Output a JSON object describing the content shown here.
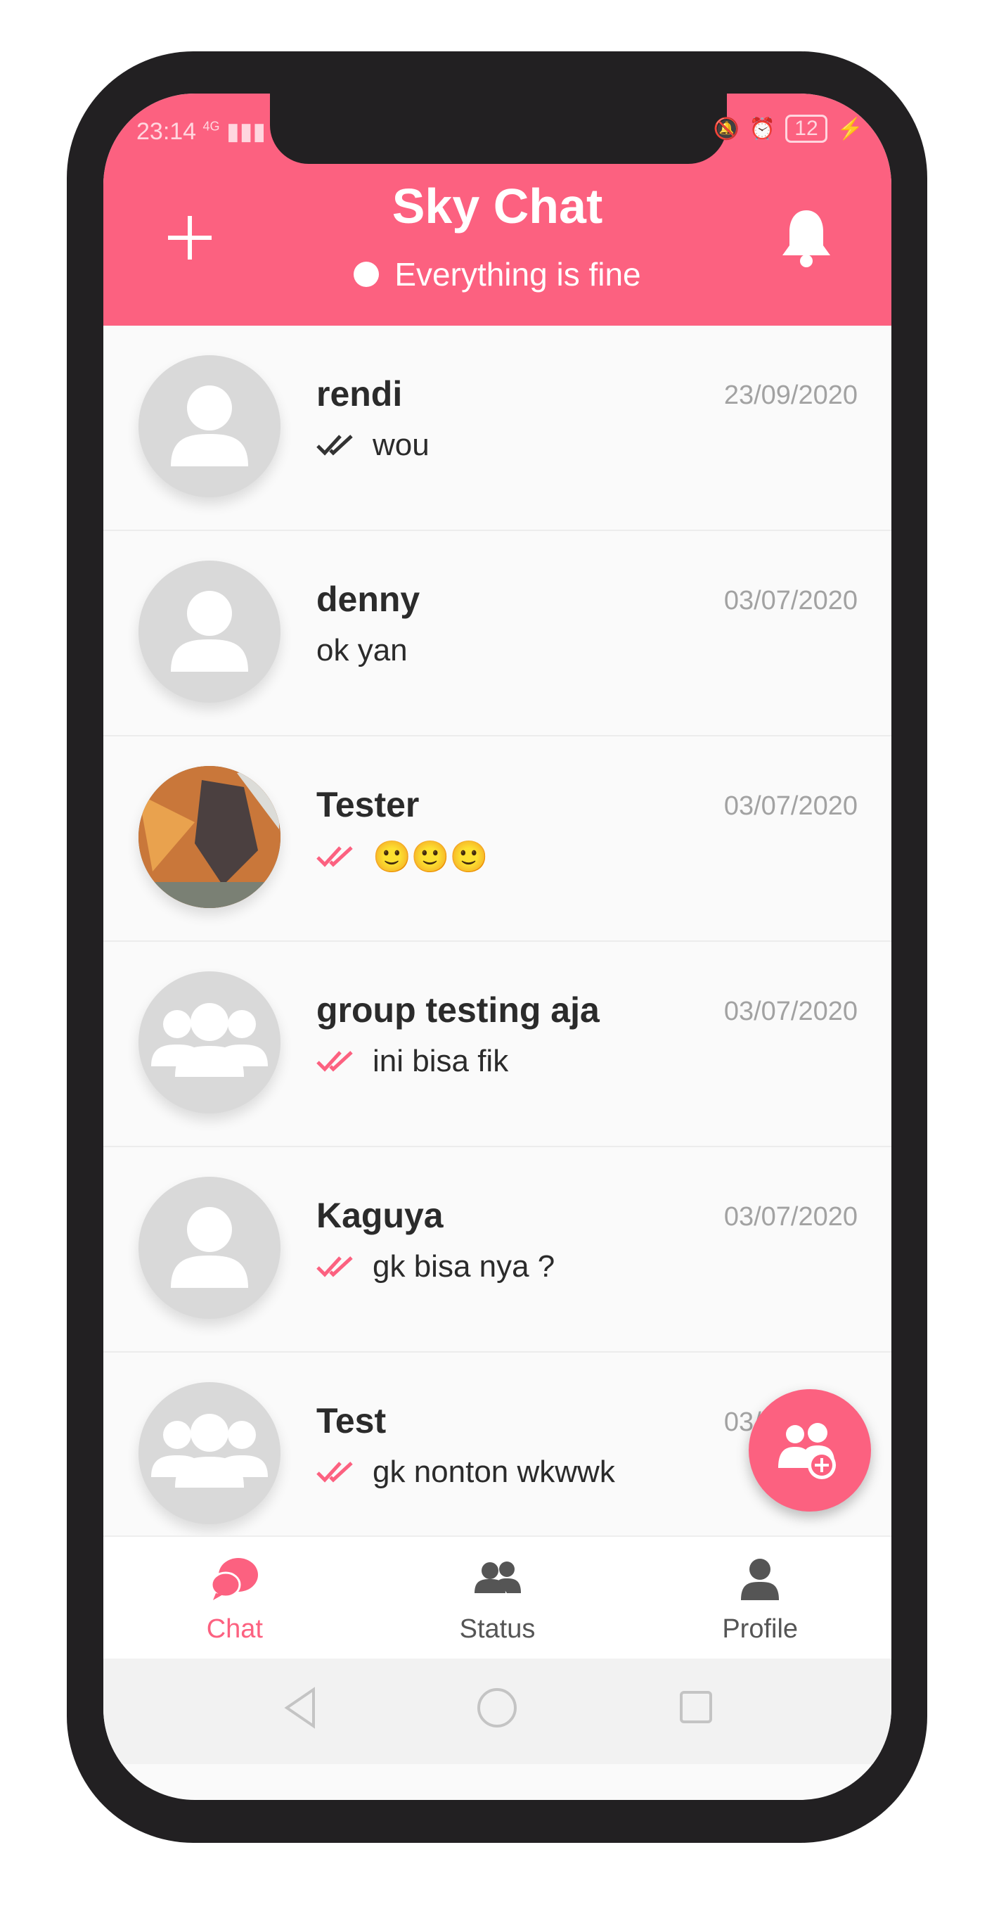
{
  "status_bar": {
    "time": "23:14",
    "signal": "4G",
    "battery": "12"
  },
  "header": {
    "title": "Sky Chat",
    "subtitle": "Everything is fine"
  },
  "chats": [
    {
      "name": "rendi",
      "date": "23/09/2020",
      "message": "wou",
      "tick": "read-dark",
      "avatar": "person-icon"
    },
    {
      "name": "denny",
      "date": "03/07/2020",
      "message": "ok yan",
      "tick": "none",
      "avatar": "person-icon"
    },
    {
      "name": "Tester",
      "date": "03/07/2020",
      "message": "🙂🙂🙂",
      "tick": "read-pink",
      "avatar": "photo"
    },
    {
      "name": "group testing aja",
      "date": "03/07/2020",
      "message": "ini bisa fik",
      "tick": "read-pink",
      "avatar": "group-icon"
    },
    {
      "name": "Kaguya",
      "date": "03/07/2020",
      "message": "gk bisa nya ?",
      "tick": "read-pink",
      "avatar": "person-icon"
    },
    {
      "name": "Test",
      "date": "03/07/2020",
      "message": "gk nonton wkwwk",
      "tick": "read-pink",
      "avatar": "group-icon"
    }
  ],
  "bottom_nav": [
    {
      "label": "Chat",
      "icon": "chat-bubbles-icon",
      "active": true
    },
    {
      "label": "Status",
      "icon": "people-icon",
      "active": false
    },
    {
      "label": "Profile",
      "icon": "person-icon",
      "active": false
    }
  ],
  "colors": {
    "accent": "#fc6180",
    "avatar_bg": "#d9d9d9"
  }
}
